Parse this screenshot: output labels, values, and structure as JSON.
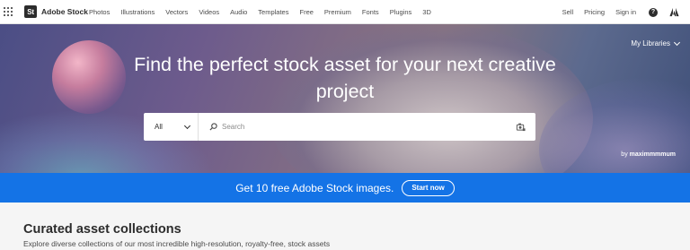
{
  "nav": {
    "brand_abbr": "St",
    "brand_name": "Adobe Stock",
    "links": [
      "Photos",
      "Illustrations",
      "Vectors",
      "Videos",
      "Audio",
      "Templates",
      "Free",
      "Premium",
      "Fonts",
      "Plugins",
      "3D"
    ],
    "right": {
      "sell": "Sell",
      "pricing": "Pricing",
      "sign_in": "Sign in",
      "help_glyph": "?"
    },
    "icons": [
      "app-grid-icon",
      "help-icon",
      "adobe-logo-icon"
    ]
  },
  "hero": {
    "title": "Find the perfect stock asset for your next creative project",
    "my_libraries": "My Libraries",
    "search": {
      "asset_type": "All",
      "placeholder": "Search",
      "icons": [
        "search-icon",
        "visual-search-icon"
      ]
    },
    "credit_prefix": "by",
    "credit_author": "maximmmmum"
  },
  "promo": {
    "text": "Get 10 free Adobe Stock images.",
    "button": "Start now",
    "color": "#1473e6"
  },
  "curated": {
    "title": "Curated asset collections",
    "subtitle": "Explore diverse collections of our most incredible high-resolution, royalty-free, stock assets"
  }
}
